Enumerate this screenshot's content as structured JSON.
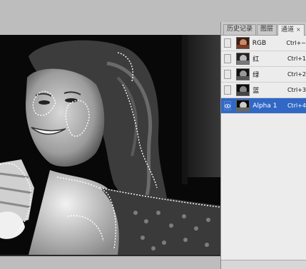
{
  "panel": {
    "tabs": [
      {
        "label": "历史记录"
      },
      {
        "label": "图层"
      },
      {
        "label": "通道",
        "close": "×"
      }
    ],
    "channels": [
      {
        "name": "RGB",
        "shortcut": "Ctrl+~",
        "thumb": "color"
      },
      {
        "name": "红",
        "shortcut": "Ctrl+1",
        "thumb": "gray"
      },
      {
        "name": "绿",
        "shortcut": "Ctrl+2",
        "thumb": "gray"
      },
      {
        "name": "蓝",
        "shortcut": "Ctrl+3",
        "thumb": "gray"
      },
      {
        "name": "Alpha 1",
        "shortcut": "Ctrl+4",
        "thumb": "gray",
        "selected": true,
        "visible": true
      }
    ]
  },
  "colors": {
    "selection_highlight": "#3168c5",
    "panel_bg": "#ececec",
    "workspace_bg": "#bdbdbd"
  },
  "icons": {
    "visibility": "eye-icon"
  }
}
